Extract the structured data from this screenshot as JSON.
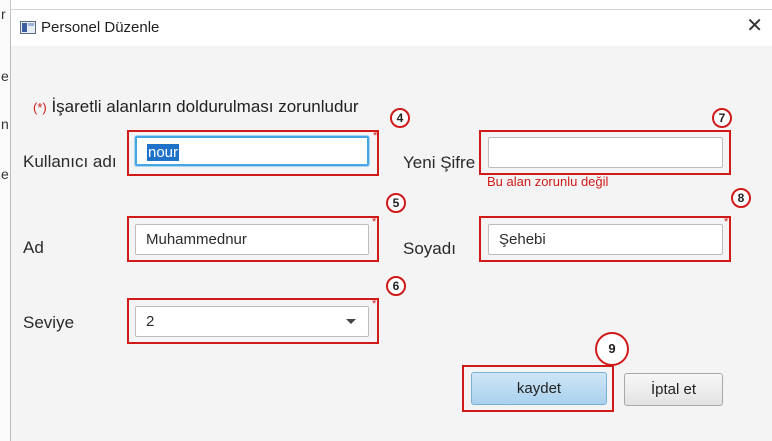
{
  "window": {
    "title": "Personel Düzenle",
    "close_glyph": "✕"
  },
  "background": {
    "glyphs": [
      "r",
      "e",
      "n",
      "e"
    ]
  },
  "form": {
    "required_marker": "(*)",
    "required_note": "İşaretli alanların doldurulması zorunludur",
    "username": {
      "label": "Kullanıcı adı",
      "value": "nour",
      "badge": "4"
    },
    "new_password": {
      "label": "Yeni Şifre",
      "value": "",
      "hint": "Bu alan zorunlu değil",
      "badge": "7"
    },
    "first_name": {
      "label": "Ad",
      "value": "Muhammednur",
      "badge": "5"
    },
    "last_name": {
      "label": "Soyadı",
      "value": "Şehebi",
      "badge": "8"
    },
    "level": {
      "label": "Seviye",
      "value": "2",
      "badge": "6"
    },
    "required_star": "*"
  },
  "buttons": {
    "save_label": "kaydet",
    "save_badge": "9",
    "cancel_label": "İptal et"
  },
  "colors": {
    "annotation_red": "#d01a1a",
    "focus_blue": "#46a6e3",
    "primary_button": "#a9d1ee"
  },
  "icons": {
    "app": "window-app-icon",
    "close": "close-icon",
    "dropdown": "chevron-down-icon"
  }
}
